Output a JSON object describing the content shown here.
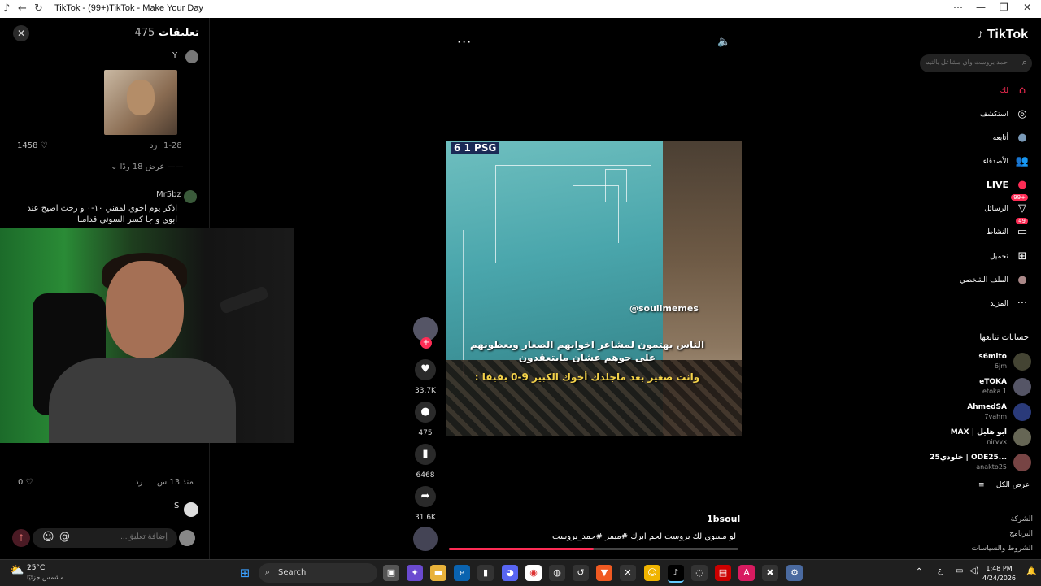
{
  "browser": {
    "title": "TikTok - (99+)TikTok - Make Your Day"
  },
  "comments": {
    "heading": "تعليقات",
    "count": "475",
    "c1": {
      "user": "Y",
      "date": "1-28",
      "reply": "رد",
      "likes": "1458"
    },
    "view_replies": "عرض 18 ردًا",
    "c2": {
      "user": "Mr5bz",
      "text": "اذكر يوم اخوي لمقني ١٠-٠ و رحت اصيح عند ابوي و جا كسر السوني قدامنا"
    },
    "c3": {
      "likes": "0",
      "reply": "رد",
      "time": "منذ 13 س",
      "user": "S"
    },
    "input_placeholder": "إضافة تعليق...",
    "at_label": "@",
    "emoji": "☺"
  },
  "player": {
    "more": "···",
    "score": "6 1 PSG",
    "username_overlay": "@soullmemes",
    "caption_line1": "الناس يهتمون لمشاعر اخوانهم الصغار ويعطونهم",
    "caption_line2": "على جوهم عشان مايتعقدون",
    "caption_line3": "وانت صغير بعد ماجلدك أخوك الكبير 9-0 بفيفا :",
    "likes": "33.7K",
    "comments": "475",
    "saves": "6468",
    "shares": "31.6K",
    "author": "1bsoul",
    "description": "لو مسوي لك بروست لحم ابرك #ميمز #حمد_بروست",
    "progress": 0.5
  },
  "sidebar": {
    "logo": "TikTok",
    "search_placeholder": "حمد بروست واي مشاغل بالتيستر...",
    "nav": [
      {
        "label": "لك",
        "icon": "⌂"
      },
      {
        "label": "استكشف",
        "icon": "◎"
      },
      {
        "label": "أتابعه",
        "icon": "●"
      },
      {
        "label": "الأصدقاء",
        "icon": "👥"
      },
      {
        "label": "LIVE",
        "icon": "●"
      },
      {
        "label": "الرسائل",
        "icon": "▽",
        "badge": "99+"
      },
      {
        "label": "النشاط",
        "icon": "▭",
        "badge": "49"
      },
      {
        "label": "تحميل",
        "icon": "⊞"
      },
      {
        "label": "الملف الشخصي",
        "icon": "●"
      },
      {
        "label": "المزيد",
        "icon": "···"
      }
    ],
    "following_header": "حسابات تتابعها",
    "accounts": [
      {
        "name": "s6mito",
        "handle": "6jm"
      },
      {
        "name": "eTOKA",
        "handle": "etoka.1"
      },
      {
        "name": "AhmedSA",
        "handle": "7vahm"
      },
      {
        "name": "MAX | ابو هليل",
        "handle": "nirvvx"
      },
      {
        "name": "خلودي25 | ODE25...",
        "handle": "anakto25"
      }
    ],
    "show_all": "عرض الكل",
    "footer": [
      "الشركة",
      "البرنامج",
      "الشروط والسياسات"
    ]
  },
  "taskbar": {
    "temp": "25°C",
    "condition": "مشمس جزئيًا",
    "search": "Search",
    "lang": "ع",
    "time": "1:48 PM",
    "date": "4/24/2026"
  }
}
